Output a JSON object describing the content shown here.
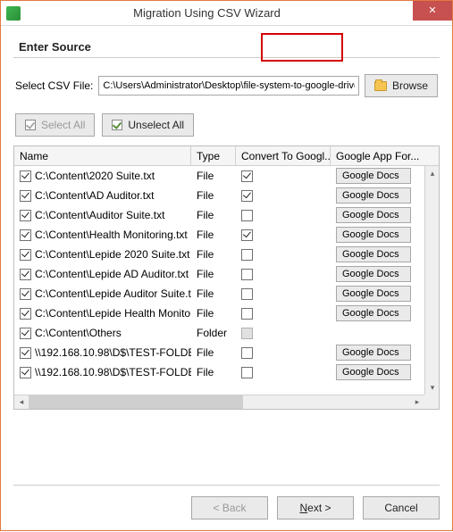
{
  "window": {
    "title": "Migration Using CSV Wizard",
    "close_symbol": "✕"
  },
  "heading": "Enter Source",
  "file_selector": {
    "label": "Select CSV File:",
    "value": "C:\\Users\\Administrator\\Desktop\\file-system-to-google-drive.csv",
    "browse_label": "Browse"
  },
  "toolbar": {
    "select_all": "Select All",
    "unselect_all": "Unselect All"
  },
  "table": {
    "headers": {
      "name": "Name",
      "type": "Type",
      "convert": "Convert To Googl...",
      "app": "Google App For..."
    },
    "app_button_label": "Google Docs",
    "rows": [
      {
        "selected": true,
        "name": "C:\\Content\\2020 Suite.txt",
        "type": "File",
        "convert": true,
        "has_app": true
      },
      {
        "selected": true,
        "name": "C:\\Content\\AD Auditor.txt",
        "type": "File",
        "convert": true,
        "has_app": true
      },
      {
        "selected": true,
        "name": "C:\\Content\\Auditor Suite.txt",
        "type": "File",
        "convert": false,
        "has_app": true
      },
      {
        "selected": true,
        "name": "C:\\Content\\Health Monitoring.txt",
        "type": "File",
        "convert": true,
        "has_app": true
      },
      {
        "selected": true,
        "name": "C:\\Content\\Lepide 2020 Suite.txt",
        "type": "File",
        "convert": false,
        "has_app": true
      },
      {
        "selected": true,
        "name": "C:\\Content\\Lepide AD Auditor.txt",
        "type": "File",
        "convert": false,
        "has_app": true
      },
      {
        "selected": true,
        "name": "C:\\Content\\Lepide Auditor Suite.txt",
        "type": "File",
        "convert": false,
        "has_app": true
      },
      {
        "selected": true,
        "name": "C:\\Content\\Lepide Health Monitorin...",
        "type": "File",
        "convert": false,
        "has_app": true
      },
      {
        "selected": true,
        "name": "C:\\Content\\Others",
        "type": "Folder",
        "convert": null,
        "has_app": false
      },
      {
        "selected": true,
        "name": "\\\\192.168.10.98\\D$\\TEST-FOLDE...",
        "type": "File",
        "convert": false,
        "has_app": true
      },
      {
        "selected": true,
        "name": "\\\\192.168.10.98\\D$\\TEST-FOLDE...",
        "type": "File",
        "convert": false,
        "has_app": true
      }
    ]
  },
  "footer": {
    "back": "< Back",
    "next_prefix": "N",
    "next_suffix": "ext >",
    "cancel": "Cancel"
  }
}
